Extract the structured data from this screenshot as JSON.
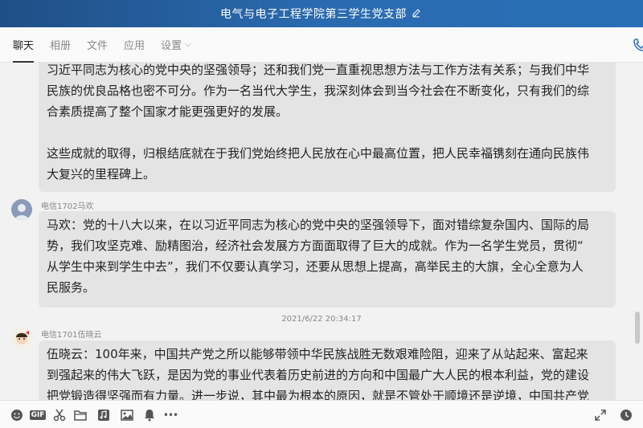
{
  "window": {
    "title": "电气与电子工程学院第三学生党支部"
  },
  "tabs": [
    {
      "label": "聊天",
      "active": true
    },
    {
      "label": "相册"
    },
    {
      "label": "文件"
    },
    {
      "label": "应用"
    },
    {
      "label": "设置"
    }
  ],
  "messages": {
    "first": {
      "lines": [
        "习近平同志为核心的党中央的坚强领导；还和我们党一直重视思想方法与工作方法有关系；与我们中华",
        "民族的优良品格也密不可分。作为一名当代大学生，我深刻体会到当今社会在不断变化，只有我们的综",
        "合素质提高了整个国家才能更强更好的发展。",
        "这些成就的取得，归根结底就在于我们党始终把人民放在心中最高位置，把人民幸福镌刻在通向民族伟",
        "大复兴的里程碑上。"
      ]
    },
    "second": {
      "sender": "电信1702马欢",
      "lines": [
        "马欢：党的十八大以来，在以习近平同志为核心的党中央的坚强领导下，面对错综复杂国内、国际的局",
        "势，我们攻坚克难、励精图治，经济社会发展方方面面取得了巨大的成就。作为一名学生党员，贯彻“",
        "从学生中来到学生中去”，我们不仅要认真学习，还要从思想上提高，高举民主的大旗，全心全意为人",
        "民服务。"
      ]
    },
    "timestamp": "2021/6/22 20:34:17",
    "third": {
      "sender": "电信1701伍晓云",
      "lines": [
        "伍晓云：100年来，中国共产党之所以能够带领中华民族战胜无数艰难险阻，迎来了从站起来、富起来",
        "到强起来的伟大飞跃，是因为党的事业代表着历史前进的方向和中国最广大人民的根本利益，党的建设",
        "把党锻造得坚强而有力量。进一步说，其中最为根本的原因，就是不管处于顺境还是逆境，中国共产党"
      ]
    }
  },
  "toolbar": {
    "icons": [
      "emoji-icon",
      "gif-icon",
      "scissors-icon",
      "folder-icon",
      "music-icon",
      "image-icon",
      "bell-icon",
      "more-icon",
      "expand-icon",
      "history-icon"
    ],
    "gif_label": "GIF",
    "more_label": "•••"
  }
}
